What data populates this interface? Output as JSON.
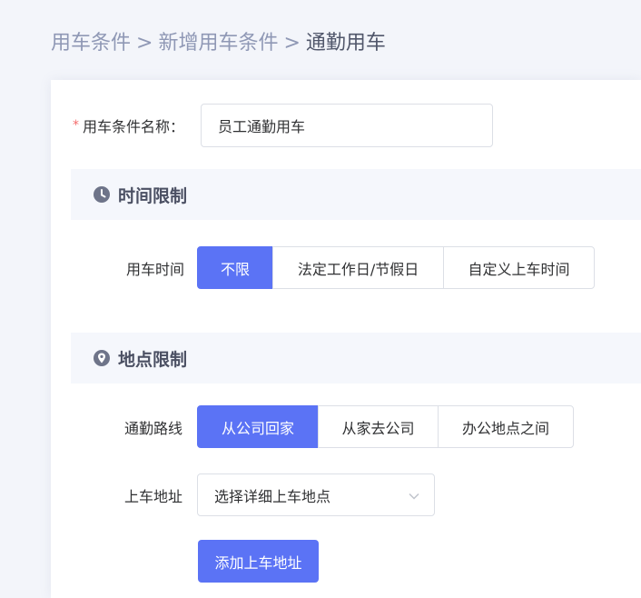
{
  "breadcrumb": {
    "items": [
      "用车条件",
      "新增用车条件"
    ],
    "separator": ">",
    "current": "通勤用车"
  },
  "form": {
    "name_label": "用车条件名称：",
    "required_mark": "*",
    "name_value": "员工通勤用车"
  },
  "time_section": {
    "title": "时间限制",
    "icon": "clock-icon",
    "label": "用车时间",
    "options": [
      "不限",
      "法定工作日/节假日",
      "自定义上车时间"
    ],
    "selected": "不限"
  },
  "location_section": {
    "title": "地点限制",
    "icon": "location-pin-icon",
    "route_label": "通勤路线",
    "route_options": [
      "从公司回家",
      "从家去公司",
      "办公地点之间"
    ],
    "route_selected": "从公司回家",
    "address_label": "上车地址",
    "address_placeholder": "选择详细上车地点",
    "add_button": "添加上车地址"
  },
  "colors": {
    "primary": "#5b73f5",
    "required": "#f56c6c",
    "breadcrumb": "#8f98b5"
  }
}
